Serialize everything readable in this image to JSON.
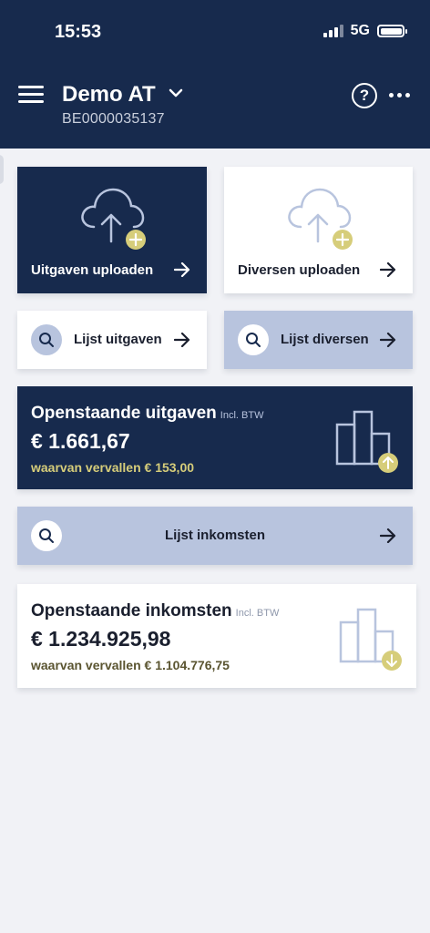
{
  "status": {
    "time": "15:53",
    "network": "5G"
  },
  "header": {
    "account_name": "Demo AT",
    "account_id": "BE0000035137",
    "help_symbol": "?"
  },
  "upload": {
    "expenses_label": "Uitgaven uploaden",
    "misc_label": "Diversen uploaden"
  },
  "lists": {
    "expenses_label": "Lijst uitgaven",
    "misc_label": "Lijst diversen",
    "income_label": "Lijst inkomsten"
  },
  "outstanding_expenses": {
    "title": "Openstaande uitgaven",
    "tax_note": "Incl. BTW",
    "amount": "€ 1.661,67",
    "overdue": "waarvan vervallen € 153,00"
  },
  "outstanding_income": {
    "title": "Openstaande inkomsten",
    "tax_note": "Incl. BTW",
    "amount": "€ 1.234.925,98",
    "overdue": "waarvan vervallen € 1.104.776,75"
  },
  "colors": {
    "navy": "#172a4d",
    "light_blue": "#b8c4de",
    "accent_gold": "#d6cd7a",
    "icon_outline": "#b8c4de",
    "income_overdue_text": "#5a5430"
  },
  "icons": [
    "menu-icon",
    "chevron-down-icon",
    "help-icon",
    "more-icon",
    "cloud-upload-icon",
    "plus-badge-icon",
    "arrow-right-icon",
    "search-icon",
    "bar-chart-icon",
    "arrow-up-badge-icon",
    "arrow-down-badge-icon"
  ]
}
